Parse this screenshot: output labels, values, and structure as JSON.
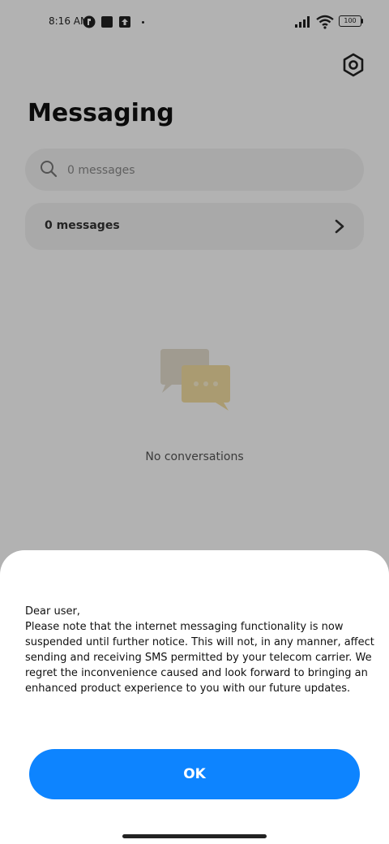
{
  "status_bar": {
    "time": "8:16 AM",
    "battery": "100"
  },
  "header": {
    "title": "Messaging",
    "settings_icon": "gear-icon"
  },
  "search": {
    "placeholder": "0 messages",
    "icon": "search-icon"
  },
  "messages_row": {
    "label": "0 messages",
    "icon": "chevron-right-icon"
  },
  "empty_state": {
    "icon": "chat-bubbles-icon",
    "text": "No conversations"
  },
  "dialog": {
    "greeting": "Dear user,",
    "body": "Please note that the internet messaging functionality is now suspended until further notice. This will not, in any manner, affect sending and receiving SMS permitted by your telecom carrier. We regret the inconvenience caused and look forward to bringing an enhanced product experience to you with our future updates.",
    "ok_label": "OK"
  },
  "colors": {
    "accent": "#0d84ff",
    "scrim": "rgba(0,0,0,0.30)"
  }
}
